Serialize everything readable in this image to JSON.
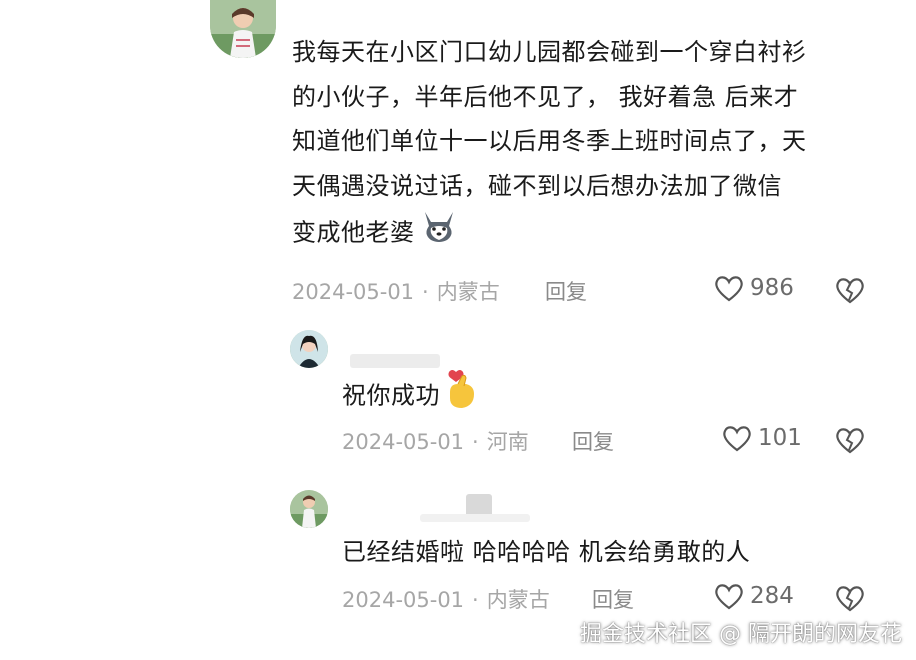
{
  "comments": [
    {
      "text_lines": [
        "我每天在小区门口幼儿园都会碰到一个穿白衬衫",
        "的小伙子，半年后他不见了，  我好着急 后来才",
        "知道他们单位十一以后用冬季上班时间点了，天",
        "天偶遇没说过话，碰不到以后想办法加了微信",
        "变成他老婆"
      ],
      "emoji": "husky-emoji",
      "date": "2024-05-01",
      "location": "内蒙古",
      "reply_label": "回复",
      "likes": "986"
    },
    {
      "text": "祝你成功",
      "emoji": "finger-heart-emoji",
      "date": "2024-05-01",
      "location": "河南",
      "reply_label": "回复",
      "likes": "101"
    },
    {
      "text": "已经结婚啦 哈哈哈哈 机会给勇敢的人",
      "date": "2024-05-01",
      "location": "内蒙古",
      "reply_label": "回复",
      "likes": "284"
    }
  ],
  "separator": "·",
  "watermark": "掘金技术社区 @ 隔开朗的网友花",
  "icons": [
    "heart-outline-icon",
    "broken-heart-icon"
  ],
  "colors": {
    "meta": "#a6a6a6",
    "text": "#1a1a1a"
  }
}
